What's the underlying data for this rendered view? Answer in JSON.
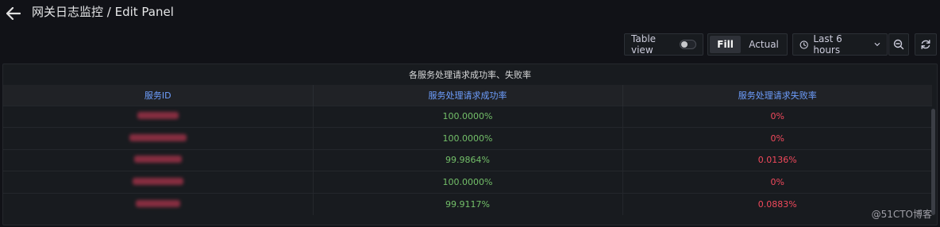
{
  "header": {
    "title": "网关日志监控 / Edit Panel"
  },
  "toolbar": {
    "table_view_label": "Table view",
    "fill_label": "Fill",
    "actual_label": "Actual",
    "time_range_label": "Last 6 hours"
  },
  "panel": {
    "title": "各服务处理请求成功率、失败率",
    "columns": [
      "服务ID",
      "服务处理请求成功率",
      "服务处理请求失败率"
    ],
    "rows": [
      {
        "service": "",
        "success": "100.0000%",
        "failure": "0%"
      },
      {
        "service": "",
        "success": "100.0000%",
        "failure": "0%"
      },
      {
        "service": "",
        "success": "99.9864%",
        "failure": "0.0136%"
      },
      {
        "service": "",
        "success": "100.0000%",
        "failure": "0%"
      },
      {
        "service": "",
        "success": "99.9117%",
        "failure": "0.0883%"
      }
    ]
  },
  "colors": {
    "success": "#73bf69",
    "failure": "#f2495c",
    "header_text": "#6e9fff"
  },
  "watermark": "@51CTO博客"
}
